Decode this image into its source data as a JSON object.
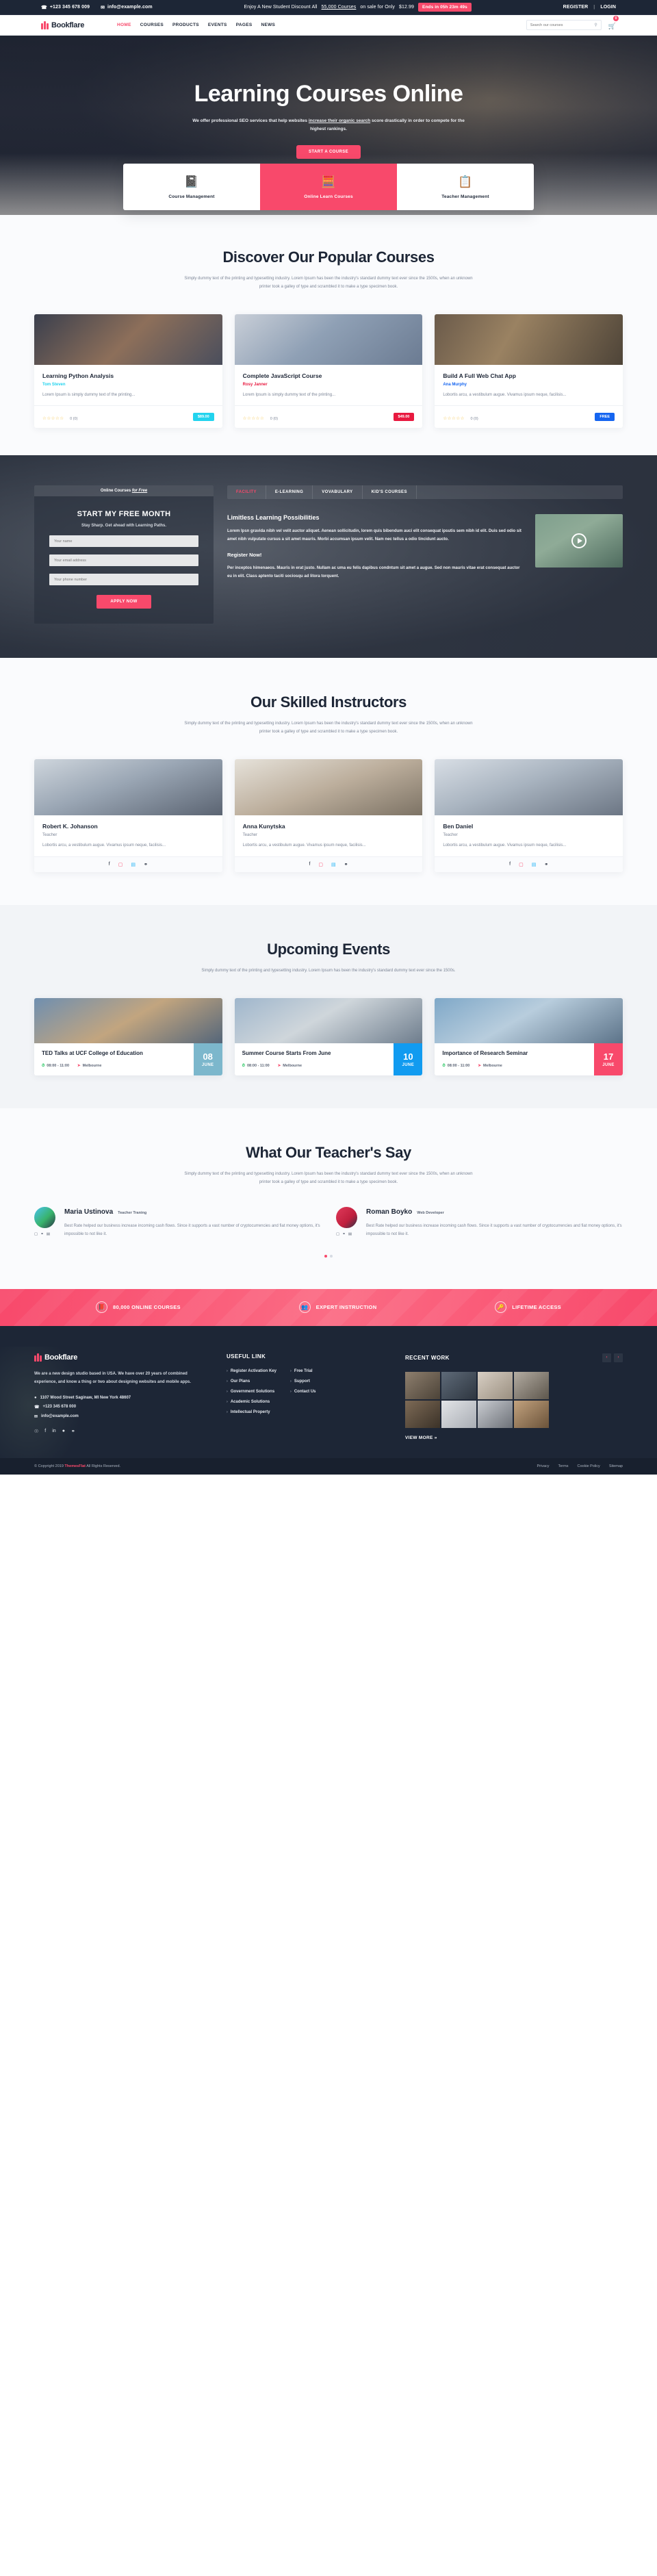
{
  "topbar": {
    "phone": "+123 345 678 009",
    "email": "info@example.com",
    "promo_prefix": "Enjoy A New Student Discount All",
    "promo_link": "55,000 Courses",
    "promo_mid": "on sale for Only",
    "promo_price": "$12.99",
    "countdown": "Ends in 05h 23m 49s",
    "register": "REGISTER",
    "login": "LOGIN",
    "phone_icon": "phone-icon",
    "email_icon": "envelope-icon"
  },
  "header": {
    "brand": "Bookflare",
    "nav": [
      {
        "label": "HOME",
        "active": true
      },
      {
        "label": "COURSES",
        "active": false
      },
      {
        "label": "PRODUCTS",
        "active": false
      },
      {
        "label": "EVENTS",
        "active": false
      },
      {
        "label": "PAGES",
        "active": false
      },
      {
        "label": "NEWS",
        "active": false
      }
    ],
    "search_placeholder": "Search our courses",
    "search_icon": "search-icon",
    "cart_icon": "cart-icon",
    "cart_count": "0"
  },
  "hero": {
    "title": "Learning Courses Online",
    "sub_before": "We offer professional SEO services that help websites ",
    "sub_link": "increase their organic search",
    "sub_after": " score drastically in order to compete for the highest rankings.",
    "cta": "START A COURSE"
  },
  "features": [
    {
      "label": "Course Management",
      "icon": "notebook-icon",
      "glyph": "📓",
      "highlight": false
    },
    {
      "label": "Online Learn Courses",
      "icon": "calculator-icon",
      "glyph": "🧮",
      "highlight": true
    },
    {
      "label": "Teacher Management",
      "icon": "clipboard-icon",
      "glyph": "📋",
      "highlight": false
    }
  ],
  "courses_section": {
    "title": "Discover Our Popular Courses",
    "subtitle": "Simply dummy text of the printing and typesetting industry. Lorem Ipsum has been the industry's standard dummy text ever since the 1500s, when an unknown printer took a galley of type and scrambled it to make a type specimen book."
  },
  "courses": [
    {
      "title": "Learning Python Analysis",
      "author": "Tom Steven",
      "author_color": "#22d3ee",
      "desc": "Lorem Ipsum is simply dummy text of the printing...",
      "stars": "☆☆☆☆☆",
      "rating": "0 (0)",
      "price": "$89.00",
      "price_color": "#22d3ee"
    },
    {
      "title": "Complete JavaScript Course",
      "author": "Rosy Janner",
      "author_color": "#e8193f",
      "desc": "Lorem Ipsum is simply dummy text of the printing...",
      "stars": "☆☆☆☆☆",
      "rating": "0 (0)",
      "price": "$49.00",
      "price_color": "#e8193f"
    },
    {
      "title": "Build A Full Web Chat App",
      "author": "Ana Murphy",
      "author_color": "#1565f0",
      "desc": "Lobortis arcu, a vestibulum augue. Vivamus ipsum neque, facilisis...",
      "stars": "☆☆☆☆☆",
      "rating": "0 (0)",
      "price": "FREE",
      "price_color": "#1565f0"
    }
  ],
  "promo": {
    "form_head_before": "Online Courses ",
    "form_head_italic": "for Free",
    "form_title": "START MY FREE MONTH",
    "form_sub": "Stay Sharp. Get ahead with Learning Paths.",
    "input_name": "Your name",
    "input_email": "Your email address",
    "input_phone": "Your phone number",
    "apply_label": "APPLY NOW",
    "tabs": [
      {
        "label": "FACILITY",
        "active": true
      },
      {
        "label": "E-LEARNING",
        "active": false
      },
      {
        "label": "VOVABULARY",
        "active": false
      },
      {
        "label": "KID'S COURSES",
        "active": false
      }
    ],
    "heading": "Limitless Learning Possibilities",
    "paragraph": "Lorem Ipsn gravida nibh vel velit auctor aliquet. Aenean sollicitudin, lorem quis bibendum auci elit consequat ipsutis sem nibh id elit. Duis sed odio sit amet nibh vulputate cursus a sit amet mauris. Morbi accumsan ipsum velit. Nam nec tellus a odio tincidunt aucto.",
    "register_heading": "Register Now!",
    "register_paragraph": "Per inceptos himenaeos. Mauris in erat justo. Nullam ac uma eu felis dapibus condntum sit amet a augue. Sed non mauris vitae erat consequat auctor eu in elit. Class aptento taciti sociosqu ad litora torquent.",
    "play_icon": "play-icon"
  },
  "instructors_section": {
    "title": "Our Skilled Instructors",
    "subtitle": "Simply dummy text of the printing and typesetting industry. Lorem Ipsum has been the industry's standard dummy text ever since the 1500s, when an unknown printer took a galley of type and scrambled it to make a type specimen book."
  },
  "instructors": [
    {
      "name": "Robert K. Johanson",
      "role": "Teacher",
      "desc": "Lobortis arcu, a vestibulum augue. Vivamus ipsum neque, facilisis..."
    },
    {
      "name": "Anna Kunytska",
      "role": "Teacher",
      "desc": "Lobortis arcu, a vestibulum augue. Vivamus ipsum neque, facilisis..."
    },
    {
      "name": "Ben Daniel",
      "role": "Teacher",
      "desc": "Lobortis arcu, a vestibulum augue. Vivamus ipsum neque, facilisis..."
    }
  ],
  "social_icons": [
    "facebook-icon",
    "instagram-icon",
    "skype-icon",
    "github-icon"
  ],
  "events_section": {
    "title": "Upcoming Events",
    "subtitle": "Simply dummy text of the printing and typesetting industry. Lorem Ipsum has been the industry's standard dummy text ever since the 1500s."
  },
  "events": [
    {
      "title": "TED Talks at UCF College of Education",
      "time": "08:00 - 11:00",
      "location": "Melbourne",
      "day": "08",
      "month": "JUNE",
      "color": "#7cb7cc"
    },
    {
      "title": "Summer Course Starts From June",
      "time": "08:00 - 11:00",
      "location": "Melbourne",
      "day": "10",
      "month": "JUNE",
      "color": "#119bf0"
    },
    {
      "title": "Importance of Research Seminar",
      "time": "08:00 - 11:00",
      "location": "Melbourne",
      "day": "17",
      "month": "JUNE",
      "color": "#f8496b"
    }
  ],
  "testimonials_section": {
    "title": "What Our Teacher's Say",
    "subtitle": "Simply dummy text of the printing and typesetting industry. Lorem Ipsum has been the industry's standard dummy text ever since the 1500s, when an unknown printer took a galley of type and scrambled it to make a type specimen book."
  },
  "testimonials": [
    {
      "name": "Maria Ustinova",
      "role": "Teacher Traning",
      "text": "Best Rate helped our business increase incoming cash flows. Since it supports a vast number of cryptocurrencies and fiat money options, it's impossible to not like it."
    },
    {
      "name": "Roman Boyko",
      "role": "Web Developer",
      "text": "Best Rate helped our business increase incoming cash flows. Since it supports a vast number of cryptocurrencies and fiat money options, it's impossible to not like it."
    }
  ],
  "strip": [
    {
      "label": "80,000 ONLINE COURSES",
      "icon": "book-icon",
      "glyph": "📕"
    },
    {
      "label": "EXPERT INSTRUCTION",
      "icon": "people-icon",
      "glyph": "👥"
    },
    {
      "label": "LIFETIME ACCESS",
      "icon": "key-icon",
      "glyph": "🔑"
    }
  ],
  "footer": {
    "brand": "Bookflare",
    "about": "We are a new design studio based in USA. We have over 20 years of combined experience, and know a thing or two about designing websites and mobile apps.",
    "address": "1107 Wood Street Saginaw, MI New York 48607",
    "phone": "+123 345 678 000",
    "email": "info@example.com",
    "social": [
      "twitter-icon",
      "facebook-icon",
      "linkedin-icon",
      "dribbble-icon",
      "behance-icon"
    ],
    "useful_title": "USEFUL LINK",
    "links_col1": [
      "Register Activation Key",
      "Our Plans",
      "Government Solutions",
      "Academic Solutions",
      "Intellectual Property"
    ],
    "links_col2": [
      "Free Trial",
      "Support",
      "Contact Us"
    ],
    "work_title": "RECENT WORK",
    "view_more": "VIEW MORE »",
    "prev_icon": "chevron-left-icon",
    "next_icon": "chevron-right-icon"
  },
  "copyright": {
    "text_before": "© Copyright 2019 ",
    "brand": "ThemesFlat",
    "text_after": " All Rights Reserved.",
    "links": [
      "Privacy",
      "Terms",
      "Cookie Policy",
      "Sitemap"
    ]
  }
}
